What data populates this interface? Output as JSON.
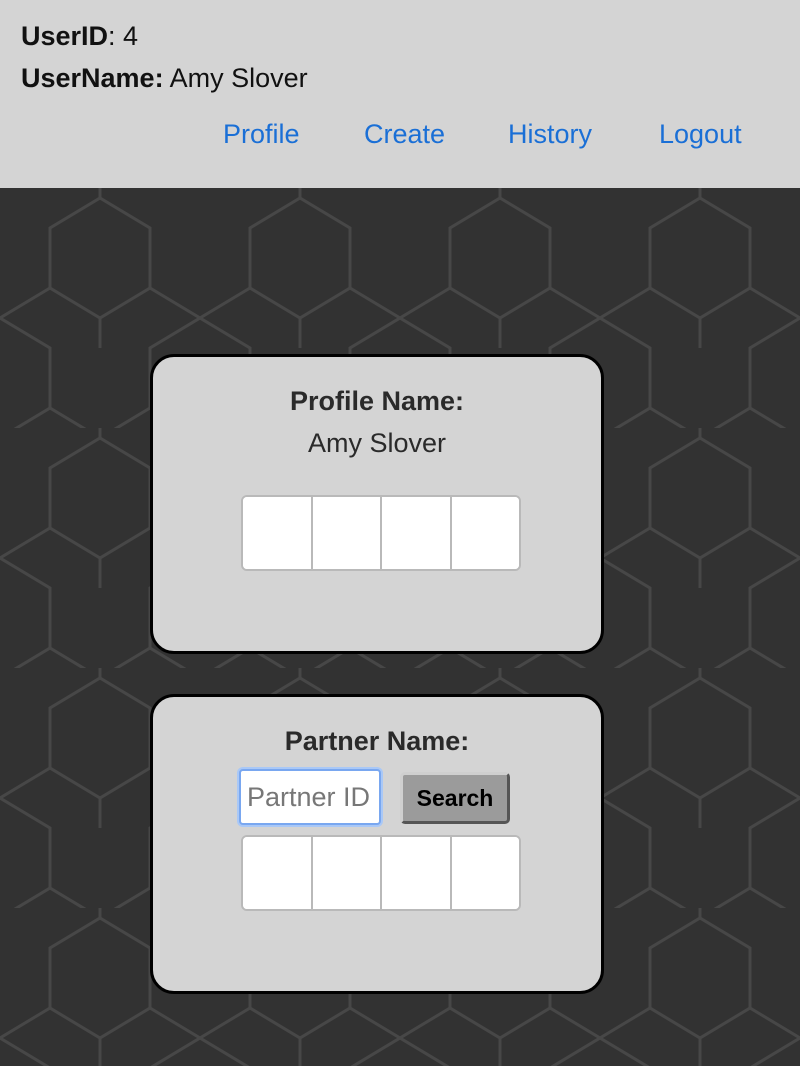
{
  "header": {
    "user_id_label": "UserID",
    "user_id_value": ": 4",
    "user_name_label": "UserName:",
    "user_name_value": " Amy Slover"
  },
  "nav": {
    "profile": "Profile",
    "create": "Create",
    "history": "History",
    "logout": "Logout"
  },
  "profile_card": {
    "title": "Profile Name:",
    "name": "Amy Slover"
  },
  "partner_card": {
    "title": "Partner Name:",
    "input_value": "",
    "input_placeholder": "Partner ID",
    "search_label": "Search"
  },
  "colors": {
    "header_bg": "#d4d4d4",
    "link": "#1a6fd6",
    "page_bg": "#323232",
    "card_bg": "#d4d4d4"
  }
}
